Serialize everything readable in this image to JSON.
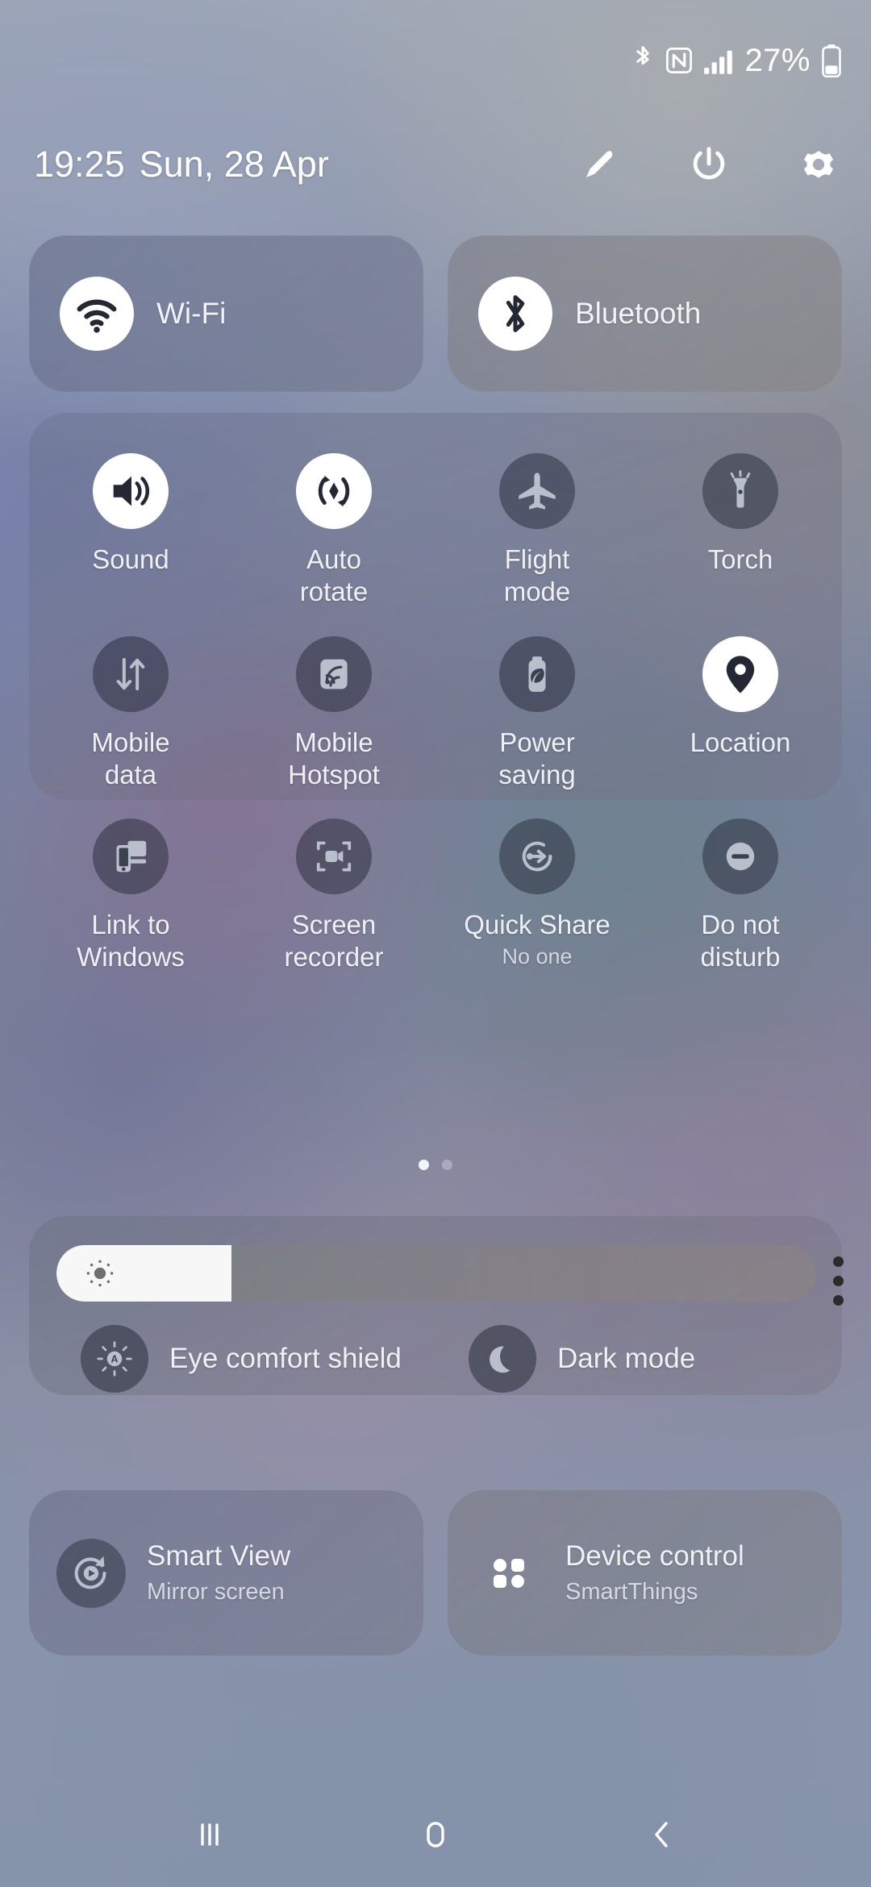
{
  "statusbar": {
    "icons": [
      "bluetooth-icon",
      "nfc-icon",
      "signal-bars-icon"
    ],
    "battery_percent": "27%",
    "battery_icon": "battery-icon"
  },
  "header": {
    "time": "19:25",
    "date": "Sun, 28 Apr",
    "actions": [
      {
        "name": "edit-pencil-icon",
        "label": "Edit"
      },
      {
        "name": "power-icon",
        "label": "Power"
      },
      {
        "name": "settings-gear-icon",
        "label": "Settings"
      }
    ]
  },
  "connectivity": [
    {
      "label": "Wi-Fi",
      "icon": "wifi-icon",
      "state": "on"
    },
    {
      "label": "Bluetooth",
      "icon": "bluetooth-icon",
      "state": "on"
    }
  ],
  "tiles": [
    {
      "label": "Sound",
      "icon": "volume-icon",
      "state": "on",
      "sub": ""
    },
    {
      "label": "Auto\nrotate",
      "icon": "auto-rotate-icon",
      "state": "on",
      "sub": ""
    },
    {
      "label": "Flight\nmode",
      "icon": "airplane-icon",
      "state": "off",
      "sub": ""
    },
    {
      "label": "Torch",
      "icon": "flashlight-icon",
      "state": "off",
      "sub": ""
    },
    {
      "label": "Mobile\ndata",
      "icon": "mobile-data-icon",
      "state": "off",
      "sub": ""
    },
    {
      "label": "Mobile\nHotspot",
      "icon": "hotspot-icon",
      "state": "off",
      "sub": ""
    },
    {
      "label": "Power\nsaving",
      "icon": "power-saving-icon",
      "state": "off",
      "sub": ""
    },
    {
      "label": "Location",
      "icon": "location-pin-icon",
      "state": "on",
      "sub": ""
    },
    {
      "label": "Link to\nWindows",
      "icon": "link-to-windows-icon",
      "state": "off",
      "sub": ""
    },
    {
      "label": "Screen\nrecorder",
      "icon": "screen-recorder-icon",
      "state": "off",
      "sub": ""
    },
    {
      "label": "Quick Share",
      "icon": "quick-share-icon",
      "state": "off",
      "sub": "No one"
    },
    {
      "label": "Do not\ndisturb",
      "icon": "do-not-disturb-icon",
      "state": "off",
      "sub": ""
    }
  ],
  "pager": {
    "pages": 2,
    "active": 1
  },
  "brightness": {
    "icon": "brightness-sun-icon",
    "value_percent": 23,
    "menu_icon": "more-vertical-icon"
  },
  "display_toggles": [
    {
      "label": "Eye comfort shield",
      "icon": "eye-comfort-shield-icon",
      "state": "off"
    },
    {
      "label": "Dark mode",
      "icon": "dark-mode-moon-icon",
      "state": "off"
    }
  ],
  "bottom_cards": [
    {
      "title": "Smart View",
      "subtitle": "Mirror screen",
      "icon": "smart-view-icon"
    },
    {
      "title": "Device control",
      "subtitle": "SmartThings",
      "icon": "device-control-grid-icon"
    }
  ],
  "navbar": [
    {
      "name": "recents-icon",
      "label": "Recents"
    },
    {
      "name": "home-icon",
      "label": "Home"
    },
    {
      "name": "back-icon",
      "label": "Back"
    }
  ],
  "colors": {
    "tile_on_bg": "#ffffff",
    "tile_on_fg": "#232834",
    "tile_off_fg": "#b9bfcb",
    "text": "#eef0f4",
    "slider_fill": "#f7f7f7"
  }
}
